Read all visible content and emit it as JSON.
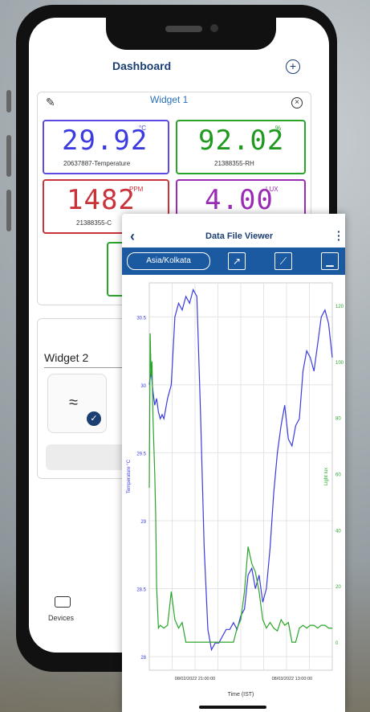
{
  "dashboard": {
    "title": "Dashboard",
    "widget1": {
      "title": "Widget 1",
      "tiles": [
        {
          "value": "29.92",
          "unit": "°C",
          "label": "20637887-Temperature",
          "color": "#5b4be0"
        },
        {
          "value": "92.02",
          "unit": "%",
          "label": "21388355-RH",
          "color": "#2aa52a"
        },
        {
          "value": "1482",
          "unit": "PPM",
          "label": "21388355-C",
          "color": "#c9333a"
        },
        {
          "value": "4.00",
          "unit": "LUX",
          "label": "",
          "color": "#9a2bb5"
        }
      ]
    },
    "widget2": {
      "title": "Widget 2"
    },
    "nav": {
      "devices_label": "Devices"
    }
  },
  "viewer": {
    "title": "Data File Viewer",
    "timezone": "Asia/Kolkata",
    "icons": [
      "share-icon",
      "chart-icon",
      "export-icon"
    ]
  },
  "chart_data": {
    "type": "line",
    "xlabel": "Time (IST)",
    "ylabel_left": "Temperature °C",
    "ylabel_right": "Light lux",
    "x_tick_labels": [
      "08/02/2022 21:00:00",
      "08/03/2022 13:00:00"
    ],
    "y_left_ticks": [
      28,
      28.5,
      29,
      29.5,
      30,
      30.5
    ],
    "y_right_ticks": [
      0,
      20,
      40,
      60,
      80,
      100,
      120
    ],
    "ylim_left": [
      27.9,
      30.75
    ],
    "ylim_right": [
      -10,
      128
    ],
    "grid": true,
    "series": [
      {
        "axis": "left",
        "color": "#3b3be0",
        "x": [
          0,
          1,
          2,
          3,
          4,
          5,
          6,
          7,
          8,
          10,
          12,
          14,
          16,
          18,
          20,
          22,
          24,
          26,
          28,
          30,
          32,
          34,
          36,
          38,
          40,
          42,
          44,
          46,
          48,
          50,
          52,
          54,
          56,
          58,
          60,
          62,
          64,
          66,
          68,
          70,
          72,
          74,
          76,
          78,
          80,
          82,
          84,
          86,
          88,
          90,
          92,
          94,
          96,
          98,
          100
        ],
        "y": [
          30.0,
          30.1,
          29.95,
          29.85,
          29.9,
          29.8,
          29.75,
          29.78,
          29.75,
          29.9,
          30.0,
          30.5,
          30.6,
          30.55,
          30.65,
          30.6,
          30.7,
          30.65,
          29.8,
          28.8,
          28.2,
          28.05,
          28.1,
          28.1,
          28.15,
          28.2,
          28.2,
          28.25,
          28.2,
          28.3,
          28.35,
          28.6,
          28.65,
          28.5,
          28.6,
          28.4,
          28.5,
          28.8,
          29.2,
          29.5,
          29.7,
          29.85,
          29.6,
          29.55,
          29.7,
          29.75,
          30.1,
          30.25,
          30.2,
          30.1,
          30.3,
          30.5,
          30.55,
          30.45,
          30.2
        ]
      },
      {
        "axis": "right",
        "color": "#2aa52a",
        "x": [
          0,
          0.5,
          1,
          1.5,
          2,
          2.5,
          3,
          3.5,
          4,
          5,
          6,
          8,
          10,
          12,
          14,
          16,
          18,
          20,
          22,
          24,
          26,
          28,
          30,
          32,
          34,
          36,
          38,
          40,
          42,
          44,
          46,
          48,
          50,
          52,
          54,
          56,
          58,
          60,
          62,
          64,
          66,
          68,
          70,
          72,
          74,
          76,
          78,
          80,
          82,
          84,
          86,
          88,
          90,
          92,
          94,
          96,
          98,
          100
        ],
        "y": [
          55,
          110,
          95,
          100,
          80,
          70,
          60,
          45,
          20,
          5,
          6,
          5,
          6,
          18,
          8,
          5,
          7,
          0,
          0,
          0,
          0,
          0,
          0,
          0,
          0,
          0,
          0,
          0,
          0,
          0,
          0,
          5,
          8,
          18,
          34,
          28,
          25,
          18,
          8,
          5,
          7,
          5,
          4,
          8,
          6,
          7,
          0,
          0,
          5,
          6,
          5,
          6,
          6,
          5,
          6,
          6,
          5,
          5
        ]
      }
    ]
  }
}
